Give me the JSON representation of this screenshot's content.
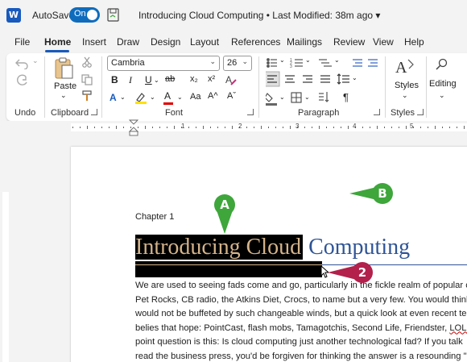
{
  "titlebar": {
    "app_icon": "word-logo-icon",
    "app_letter": "W",
    "autosave_label": "AutoSave",
    "toggle_state": "On",
    "document_title": "Introducing Cloud Computing • Last Modified: 38m ago",
    "title_chevron": "▾"
  },
  "tabs": [
    "File",
    "Home",
    "Insert",
    "Draw",
    "Design",
    "Layout",
    "References",
    "Mailings",
    "Review",
    "View",
    "Help"
  ],
  "active_tab": "Home",
  "ribbon": {
    "undo_group": "Undo",
    "clipboard_group": "Clipboard",
    "font_group": "Font",
    "paragraph_group": "Paragraph",
    "styles_group": "Styles",
    "paste_label": "Paste",
    "font_name": "Cambria",
    "font_size": "26",
    "styles_label": "Styles",
    "editing_label": "Editing",
    "bold": "B",
    "italic": "I",
    "underline": "U",
    "strike": "ab",
    "subscript": "x₂",
    "superscript": "x²",
    "grow_font": "A^",
    "shrink_font": "Aˇ",
    "case": "Aa",
    "pilcrow": "¶",
    "dropdown": "⌄",
    "highlight_color": "#ffe000",
    "font_color": "#e00000",
    "text_effect_color": "#185abd"
  },
  "ruler": {
    "numbers": [
      "1",
      "2",
      "3",
      "4",
      "5"
    ]
  },
  "document": {
    "chapter": "Chapter 1",
    "heading_selected": "Introducing Cloud",
    "heading_rest": " Computing",
    "lines": [
      "We are used to seeing fads come and go, particularly in the fickle realm of popular c",
      "Pet Rocks, CB radio, the Atkins Diet, Crocs, to name but a very few. You would think",
      "would not be buffeted by such changeable winds, but a quick look at even recent te",
      "point question is this: Is cloud computing just another technological fad? If you talk",
      "read the business press, you'd be forgiven for thinking the answer is a resounding \""
    ],
    "line4_pre": "belies that hope: PointCast, flash mobs, Tamagotchis, Second Life, Friendster, ",
    "line4_err": "LOLca"
  },
  "callouts": {
    "a": "A",
    "b": "B",
    "two": "2"
  },
  "colors": {
    "accent": "#185abd",
    "heading_blue": "#2f5496",
    "callout_green": "#3ea63b",
    "callout_red": "#b2204b",
    "selection": "#000000"
  }
}
